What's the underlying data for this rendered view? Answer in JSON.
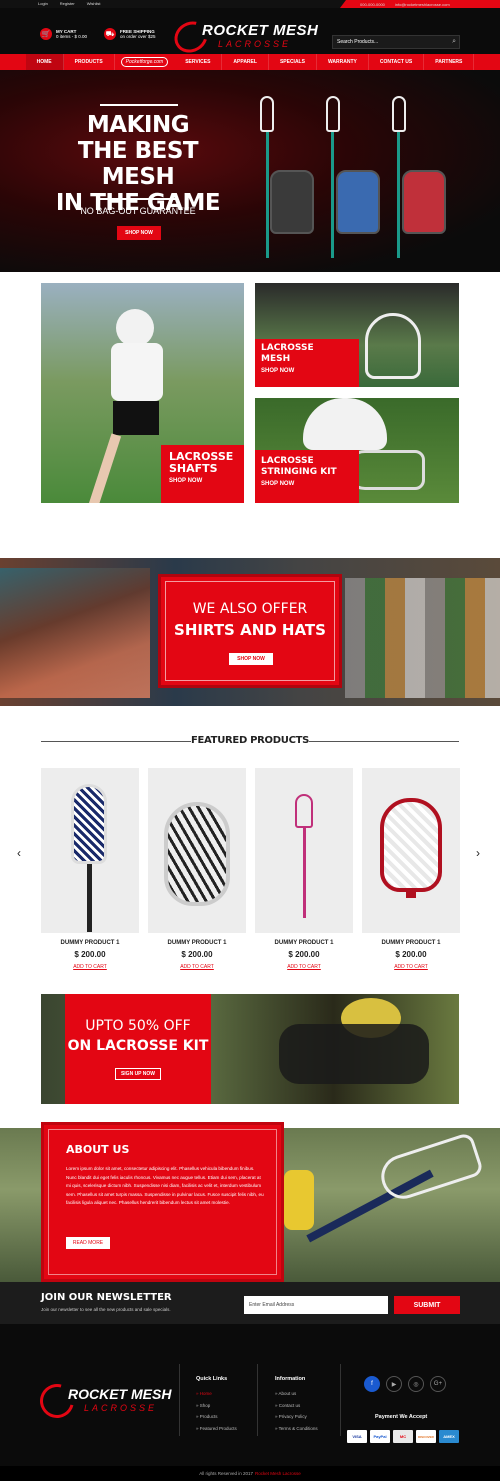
{
  "topbar": {
    "links": [
      "Login",
      "Register",
      "Wishlist"
    ],
    "phone": "000-000-0000",
    "email": "info@rocketmeshlacrosse.com"
  },
  "header": {
    "cart_title": "MY CART",
    "cart_detail": "0 items - $ 0.00",
    "shipping_title": "FREE SHIPPING",
    "shipping_detail": "on order over $25",
    "logo_line1": "ROCKET MESH",
    "logo_line2": "LACROSSE",
    "search_placeholder": "Search Products..."
  },
  "nav": {
    "items": [
      "HOME",
      "PRODUCTS",
      "SERVICES",
      "APPAREL",
      "SPECIALS",
      "WARRANTY",
      "CONTACT US",
      "PARTNERS"
    ],
    "partner_badge": "Pocketforge.com"
  },
  "hero": {
    "title_lines": [
      "MAKING",
      "THE BEST MESH",
      "IN THE GAME"
    ],
    "subtitle": "NO BAG-OUT GUARANTEE",
    "button": "SHOP NOW"
  },
  "categories": [
    {
      "title_lines": [
        "LACROSSE",
        "SHAFTS"
      ],
      "cta": "SHOP NOW"
    },
    {
      "title_lines": [
        "LACROSSE",
        "MESH"
      ],
      "cta": "SHOP NOW"
    },
    {
      "title_lines": [
        "LACROSSE",
        "STRINGING KIT"
      ],
      "cta": "SHOP NOW"
    }
  ],
  "offer": {
    "line1": "WE ALSO OFFER",
    "line2": "SHIRTS AND HATS",
    "button": "SHOP NOW"
  },
  "featured": {
    "title": "FEATURED PRODUCTS",
    "prev": "‹",
    "next": "›",
    "products": [
      {
        "name": "DUMMY PRODUCT 1",
        "price": "$ 200.00",
        "cta": "ADD TO CART",
        "color": "#1a2a6a"
      },
      {
        "name": "DUMMY PRODUCT 1",
        "price": "$ 200.00",
        "cta": "ADD TO CART",
        "color": "#222222"
      },
      {
        "name": "DUMMY PRODUCT 1",
        "price": "$ 200.00",
        "cta": "ADD TO CART",
        "color": "#c0307a"
      },
      {
        "name": "DUMMY PRODUCT 1",
        "price": "$ 200.00",
        "cta": "ADD TO CART",
        "color": "#b01020"
      }
    ]
  },
  "promo": {
    "line1": "UPTO 50% OFF",
    "line2": "ON LACROSSE KIT",
    "button": "SIGN UP NOW"
  },
  "about": {
    "title": "ABOUT US",
    "body": "Lorem ipsum dolor sit amet, consectetur adipiscing elit. Phasellus vehicula bibendum finibus. Nunc blandit dui eget felis iaculis rhoncus. Vivamus nec augue tellus. Etiam dui sem, placerat at mi quis, scelerisque dictum nibh. Suspendisse nisi diam, facilisis ac velit et, interdum vestibulum sem. Phasellus sit amet turpis massa. Suspendisse in pulvinar lacus. Fusce suscipit felis nibh, eu facilisis ligula aliquet nec. Phasellus hendrerit bibendum lectus sit amet molestie.",
    "button": "READ MORE"
  },
  "newsletter": {
    "title": "JOIN OUR NEWSLETTER",
    "text": "Join our newsletter to see all the new products and sale specials.",
    "placeholder": "Enter Email Address",
    "button": "SUBMIT"
  },
  "footer": {
    "logo_line1": "ROCKET MESH",
    "logo_line2": "LACROSSE",
    "quick_links_title": "Quick Links",
    "quick_links": [
      "Home",
      "Shop",
      "Products",
      "Featured Products"
    ],
    "info_title": "Information",
    "info_links": [
      "About us",
      "Contact us",
      "Privacy Policy",
      "Terms & Conditions"
    ],
    "social": [
      "f",
      "▶",
      "◎",
      "G+"
    ],
    "payment_title": "Payment We Accept",
    "cards": [
      "VISA",
      "PayPal",
      "MC",
      "DISCOVER",
      "AMEX"
    ],
    "copyright_prefix": "All rights Reserved in 2017",
    "copyright_brand": "Rocket Mesh Lacrosse"
  }
}
